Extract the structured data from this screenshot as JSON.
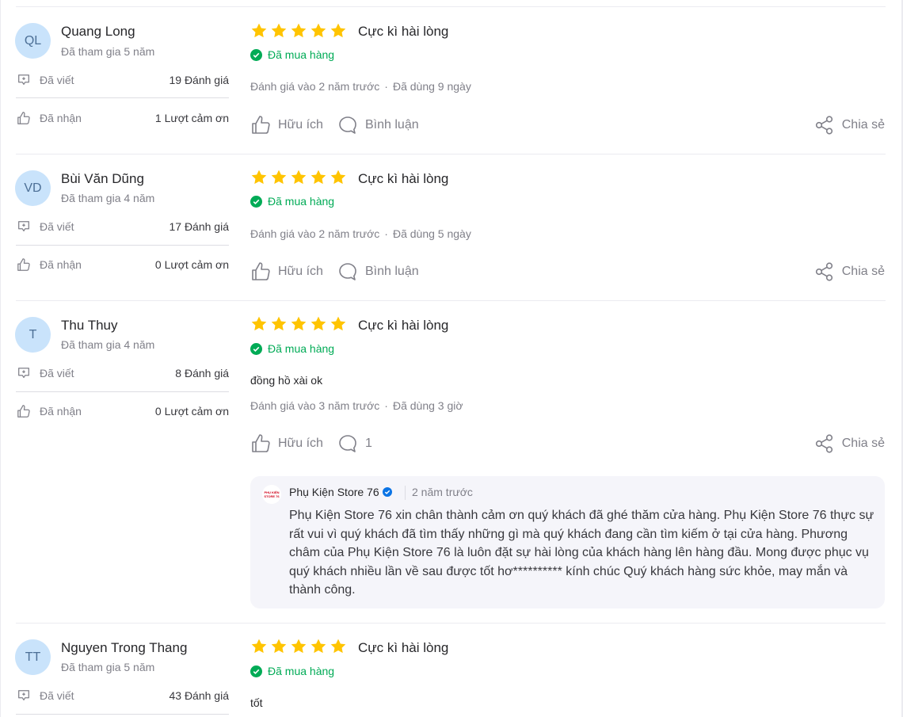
{
  "reviews": [
    {
      "initials": "QL",
      "name": "Quang Long",
      "joined": "Đã tham gia 5 năm",
      "written_label": "Đã viết",
      "written_value": "19 Đánh giá",
      "received_label": "Đã nhận",
      "received_value": "1 Lượt cảm ơn",
      "stars": 5,
      "rating_text": "Cực kì hài lòng",
      "bought": "Đã mua hàng",
      "content": "",
      "reviewed_at": "Đánh giá vào 2 năm trước",
      "used_for": "Đã dùng 9 ngày",
      "helpful_label": "Hữu ích",
      "comment_label": "Bình luận",
      "share_label": "Chia sẻ"
    },
    {
      "initials": "VD",
      "name": "Bùi Văn Dũng",
      "joined": "Đã tham gia 4 năm",
      "written_label": "Đã viết",
      "written_value": "17 Đánh giá",
      "received_label": "Đã nhận",
      "received_value": "0 Lượt cảm ơn",
      "stars": 5,
      "rating_text": "Cực kì hài lòng",
      "bought": "Đã mua hàng",
      "content": "",
      "reviewed_at": "Đánh giá vào 2 năm trước",
      "used_for": "Đã dùng 5 ngày",
      "helpful_label": "Hữu ích",
      "comment_label": "Bình luận",
      "share_label": "Chia sẻ"
    },
    {
      "initials": "T",
      "name": "Thu Thuy",
      "joined": "Đã tham gia 4 năm",
      "written_label": "Đã viết",
      "written_value": "8 Đánh giá",
      "received_label": "Đã nhận",
      "received_value": "0 Lượt cảm ơn",
      "stars": 5,
      "rating_text": "Cực kì hài lòng",
      "bought": "Đã mua hàng",
      "content": "đồng hồ xài ok",
      "reviewed_at": "Đánh giá vào 3 năm trước",
      "used_for": "Đã dùng 3 giờ",
      "helpful_label": "Hữu ích",
      "comment_label": "1",
      "share_label": "Chia sẻ",
      "reply": {
        "logo_line1": "PHỤ KIỆN",
        "logo_line2": "STORE 76",
        "shop_name": "Phụ Kiện Store 76",
        "time": "2 năm trước",
        "text": "Phụ Kiện Store 76 xin chân thành cảm ơn quý khách đã ghé thăm cửa hàng. Phụ Kiện Store 76 thực sự rất vui vì quý khách đã tìm thấy những gì mà quý khách đang cần tìm kiếm ở tại cửa hàng. Phương châm của Phụ Kiện Store 76 là luôn đặt sự hài lòng của khách hàng lên hàng đầu. Mong được phục vụ quý khách nhiều lần về sau được tốt hơ********** kính chúc Quý khách hàng sức khỏe, may mắn và thành công."
      }
    },
    {
      "initials": "TT",
      "name": "Nguyen Trong Thang",
      "joined": "Đã tham gia 5 năm",
      "written_label": "Đã viết",
      "written_value": "43 Đánh giá",
      "stars": 5,
      "rating_text": "Cực kì hài lòng",
      "bought": "Đã mua hàng",
      "content": "tốt"
    }
  ],
  "colors": {
    "star": "#ffc400",
    "verified": "#00ab56",
    "avatar_bg": "#c9e3fb",
    "badge": "#0b74e5"
  },
  "icons": [
    "write-review-icon",
    "thumbs-up-icon",
    "comment-icon",
    "share-icon",
    "check-circle-icon",
    "star-icon",
    "verified-badge-icon"
  ]
}
